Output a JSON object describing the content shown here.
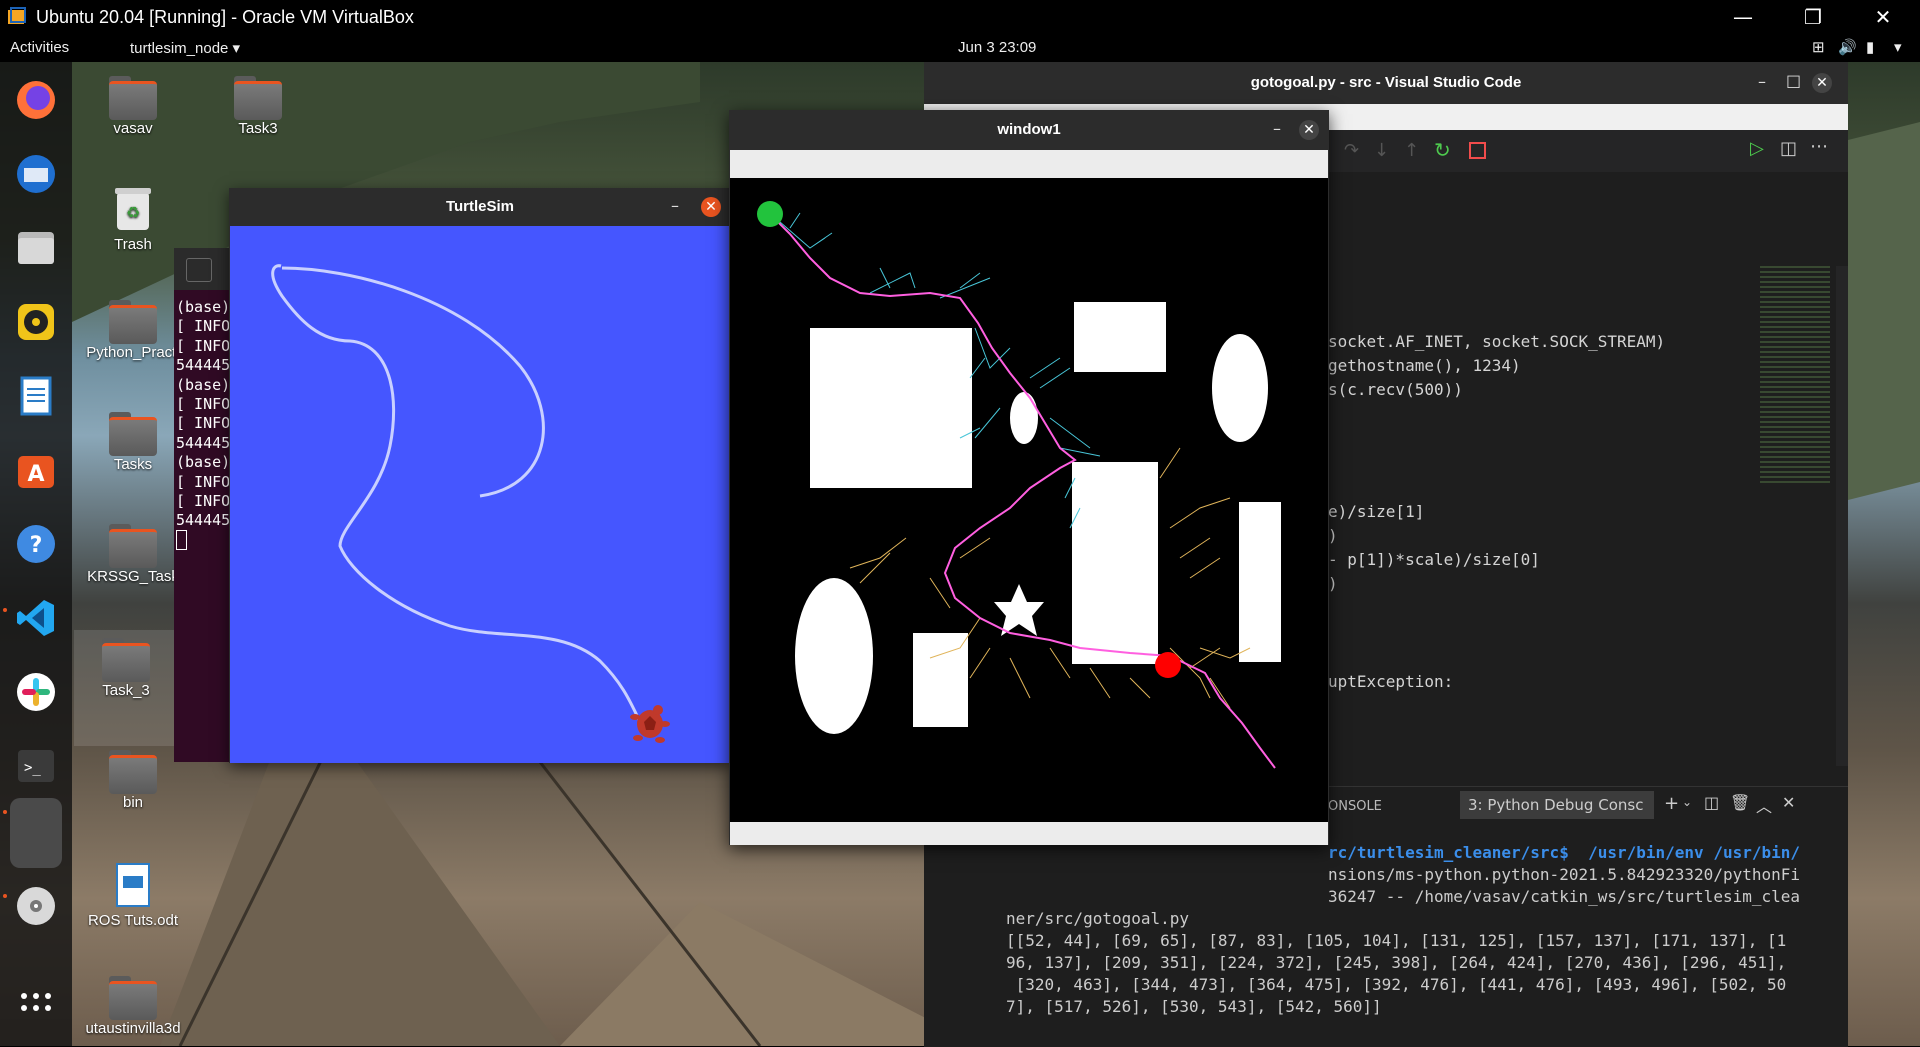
{
  "vbox": {
    "title": "Ubuntu 20.04 [Running] - Oracle VM VirtualBox",
    "minimize": "—",
    "restore": "❐",
    "close": "✕"
  },
  "topbar": {
    "activities": "Activities",
    "app_menu": "turtlesim_node ▾",
    "datetime": "Jun 3  23:09"
  },
  "desktop_icons": [
    {
      "label": "vasav"
    },
    {
      "label": "Task3"
    },
    {
      "label": "Trash"
    },
    {
      "label": "Python_Practi"
    },
    {
      "label": "Tasks"
    },
    {
      "label": "KRSSG_Task"
    },
    {
      "label": "Task_3"
    },
    {
      "label": "bin"
    },
    {
      "label": "ROS Tuts.odt"
    },
    {
      "label": "utaustinvilla3d"
    }
  ],
  "terminal": {
    "lines": "(base)\n[ INFO\n[ INFO\n544445\n(base)\n[ INFO\n[ INFO\n544445\n(base)\n[ INFO\n[ INFO\n544445"
  },
  "turtlesim": {
    "title": "TurtleSim",
    "bg_color": "#4556ff"
  },
  "window1": {
    "title": "window1"
  },
  "vscode": {
    "title": "gotogoal.py - src - Visual Studio Code",
    "code_lines": [
      "socket.AF_INET, socket.SOCK_STREAM)",
      "gethostname(), 1234)",
      "s(c.recv(500))",
      "e)/size[1]",
      ")",
      "- p[1])*scale)/size[0]",
      ")",
      "uptException:"
    ],
    "panel_tab": "ONSOLE",
    "debug_dropdown": "3: Python Debug Consc",
    "terminal_lines": [
      "rc/turtlesim_cleaner/src$  /usr/bin/env /usr/bin/",
      "nsions/ms-python.python-2021.5.842923320/pythonFi",
      "36247 -- /home/vasav/catkin_ws/src/turtlesim_clea",
      "ner/src/gotogoal.py",
      "[[52, 44], [69, 65], [87, 83], [105, 104], [131, 125], [157, 137], [171, 137], [1",
      "96, 137], [209, 351], [224, 372], [245, 398], [264, 424], [270, 436], [296, 451],",
      " [320, 463], [344, 473], [364, 475], [392, 476], [441, 476], [493, 496], [502, 50",
      "7], [517, 526], [530, 543], [542, 560]]"
    ]
  }
}
